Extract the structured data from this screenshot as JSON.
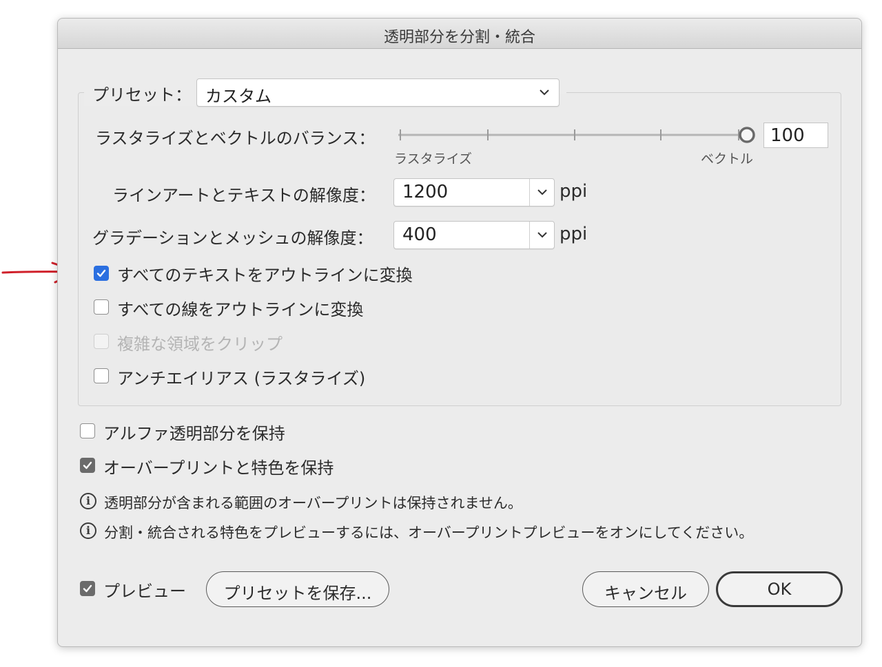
{
  "dialog": {
    "title": "透明部分を分割・統合",
    "preset": {
      "label": "プリセット：",
      "value": "カスタム"
    },
    "balance": {
      "label": "ラスタライズとベクトルのバランス：",
      "left_label": "ラスタライズ",
      "right_label": "ベクトル",
      "value": "100",
      "level_percent": 100
    },
    "lineart_resolution": {
      "label": "ラインアートとテキストの解像度：",
      "value": "1200",
      "unit": "ppi"
    },
    "gradient_resolution": {
      "label": "グラデーションとメッシュの解像度：",
      "value": "400",
      "unit": "ppi"
    },
    "options": [
      {
        "label": "すべてのテキストをアウトラインに変換",
        "checked": true,
        "enabled": true
      },
      {
        "label": "すべての線をアウトラインに変換",
        "checked": false,
        "enabled": true
      },
      {
        "label": "複雑な領域をクリップ",
        "checked": false,
        "enabled": false
      },
      {
        "label": "アンチエイリアス (ラスタライズ)",
        "checked": false,
        "enabled": true
      }
    ],
    "preserve_alpha": {
      "label": "アルファ透明部分を保持",
      "checked": false
    },
    "preserve_overprint": {
      "label": "オーバープリントと特色を保持",
      "checked": true
    },
    "info": [
      "透明部分が含まれる範囲のオーバープリントは保持されません。",
      "分割・統合される特色をプレビューするには、オーバープリントプレビューをオンにしてください。"
    ],
    "preview": {
      "label": "プレビュー",
      "checked": true
    },
    "buttons": {
      "save_preset": "プリセットを保存...",
      "cancel": "キャンセル",
      "ok": "OK"
    }
  },
  "colors": {
    "annotation_arrow": "#d0202a",
    "checkbox_accent": "#2b6fe0"
  }
}
